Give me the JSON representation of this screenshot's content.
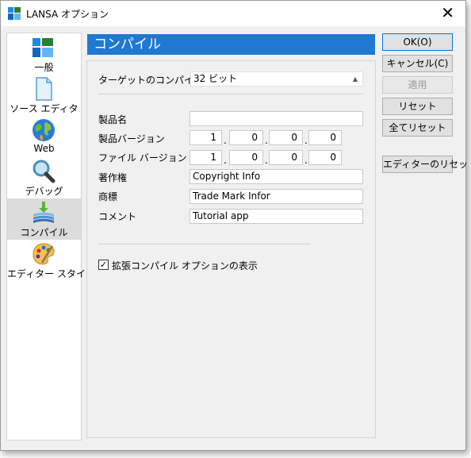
{
  "window": {
    "title": "LANSA オプション"
  },
  "nav": {
    "items": [
      {
        "label": "一般",
        "icon": "general-tiles-icon"
      },
      {
        "label": "ソース エディタ",
        "icon": "document-icon"
      },
      {
        "label": "Web",
        "icon": "globe-icon"
      },
      {
        "label": "デバッグ",
        "icon": "magnifier-icon"
      },
      {
        "label": "コンパイル",
        "icon": "compile-layers-icon",
        "selected": true
      },
      {
        "label": "エディター スタイル",
        "icon": "palette-icon"
      }
    ]
  },
  "panel": {
    "title": "コンパイル",
    "target_label": "ターゲットのコンパイル",
    "target_value": "32 ビット",
    "product_name_label": "製品名",
    "product_name_value": "",
    "product_version_label": "製品バージョン",
    "product_version": [
      "1",
      "0",
      "0",
      "0"
    ],
    "file_version_label": "ファイル バージョン",
    "file_version": [
      "1",
      "0",
      "0",
      "0"
    ],
    "copyright_label": "著作権",
    "copyright_value": "Copyright Info",
    "trademark_label": "商標",
    "trademark_value": "Trade Mark Infor",
    "comment_label": "コメント",
    "comment_value": "Tutorial app",
    "show_extended_label": "拡張コンパイル オプションの表示",
    "show_extended_checked": true
  },
  "buttons": {
    "ok": "OK(O)",
    "cancel": "キャンセル(C)",
    "apply": "適用",
    "reset": "リセット",
    "reset_all": "全てリセット",
    "reset_editor": "エディターのリセット"
  },
  "colors": {
    "header_blue": "#1f78d1",
    "selected_nav": "#dcdcdc"
  }
}
